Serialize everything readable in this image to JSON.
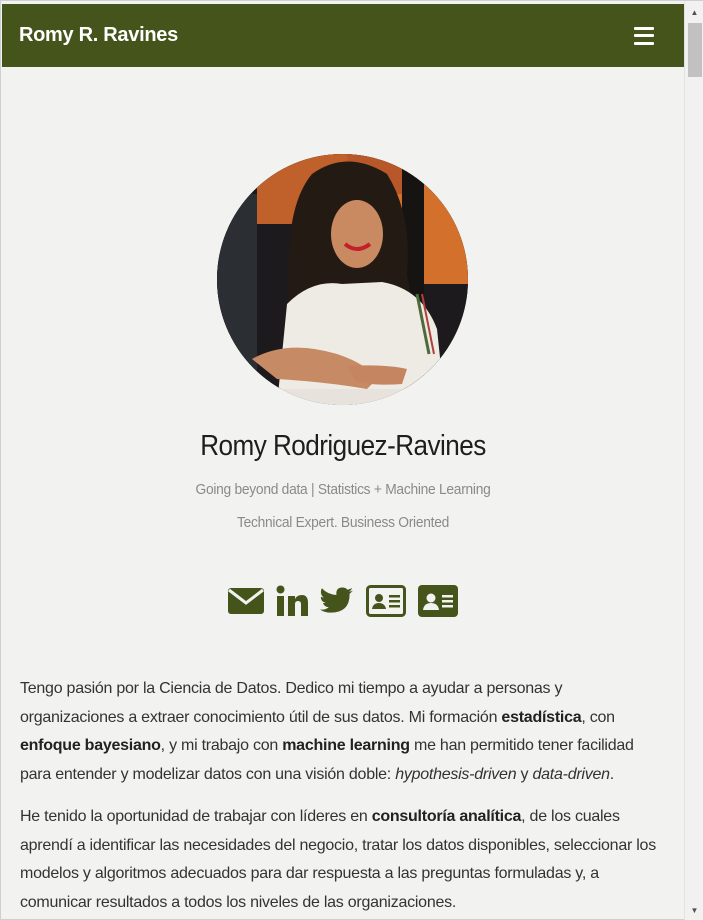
{
  "navbar": {
    "brand": "Romy R. Ravines",
    "menu_icon": "hamburger-menu-icon"
  },
  "profile": {
    "name": "Romy Rodriguez-Ravines",
    "tagline": "Going beyond data | Statistics + Machine Learning",
    "tagline2": "Technical Expert. Business Oriented"
  },
  "social_icons": [
    "envelope-icon",
    "linkedin-icon",
    "twitter-icon",
    "id-card-outline-icon",
    "id-card-solid-icon"
  ],
  "colors": {
    "accent": "#44541a",
    "background": "#f2f2f0"
  },
  "about": {
    "p1": {
      "t1": "Tengo pasión por la Ciencia de Datos. Dedico mi tiempo a ayudar a personas y organizaciones a extraer conocimiento útil de sus datos. Mi formación ",
      "b1": "estadística",
      "t2": ", con ",
      "b2": "enfoque bayesiano",
      "t3": ", y mi trabajo con ",
      "b3": "machine learning",
      "t4": " me han permitido tener facilidad para entender y modelizar datos con una visión doble: ",
      "i1": "hypothesis-driven",
      "t5": " y ",
      "i2": "data-driven",
      "t6": "."
    },
    "p2": {
      "t1": "He tenido la oportunidad de trabajar con líderes en ",
      "b1": "consultoría analítica",
      "t2": ", de los cuales aprendí a identificar las necesidades del negocio, tratar los datos disponibles, seleccionar los modelos y algoritmos adecuados para dar respuesta a las preguntas formuladas y, a comunicar resultados a todos los niveles de las organizaciones."
    }
  }
}
